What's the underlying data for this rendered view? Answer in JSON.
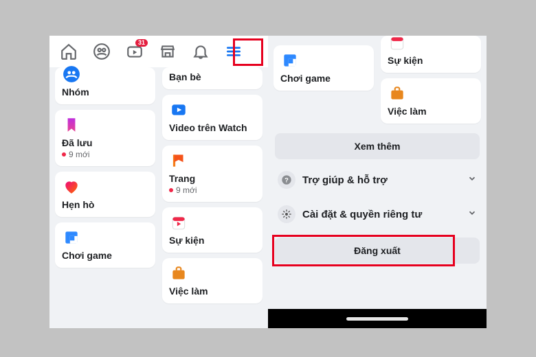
{
  "nav": {
    "badge_watch": "31"
  },
  "left": {
    "col1": [
      {
        "icon": "groups",
        "label": "Nhóm"
      },
      {
        "icon": "saved",
        "label": "Đã lưu",
        "sub": "9 mới"
      },
      {
        "icon": "dating",
        "label": "Hẹn hò"
      },
      {
        "icon": "gaming",
        "label": "Chơi game"
      }
    ],
    "col2": [
      {
        "icon": "friends",
        "label": "Bạn bè"
      },
      {
        "icon": "watch",
        "label": "Video trên Watch"
      },
      {
        "icon": "pages",
        "label": "Trang",
        "sub": "9 mới"
      },
      {
        "icon": "events",
        "label": "Sự kiện"
      },
      {
        "icon": "jobs",
        "label": "Việc làm"
      }
    ]
  },
  "right": {
    "col1": [
      {
        "icon": "gaming",
        "label": "Chơi game"
      }
    ],
    "col2": [
      {
        "icon": "events",
        "label": "Sự kiện"
      },
      {
        "icon": "jobs",
        "label": "Việc làm"
      }
    ],
    "see_more": "Xem thêm",
    "help": "Trợ giúp & hỗ trợ",
    "settings": "Cài đặt & quyền riêng tư",
    "logout": "Đăng xuất"
  }
}
